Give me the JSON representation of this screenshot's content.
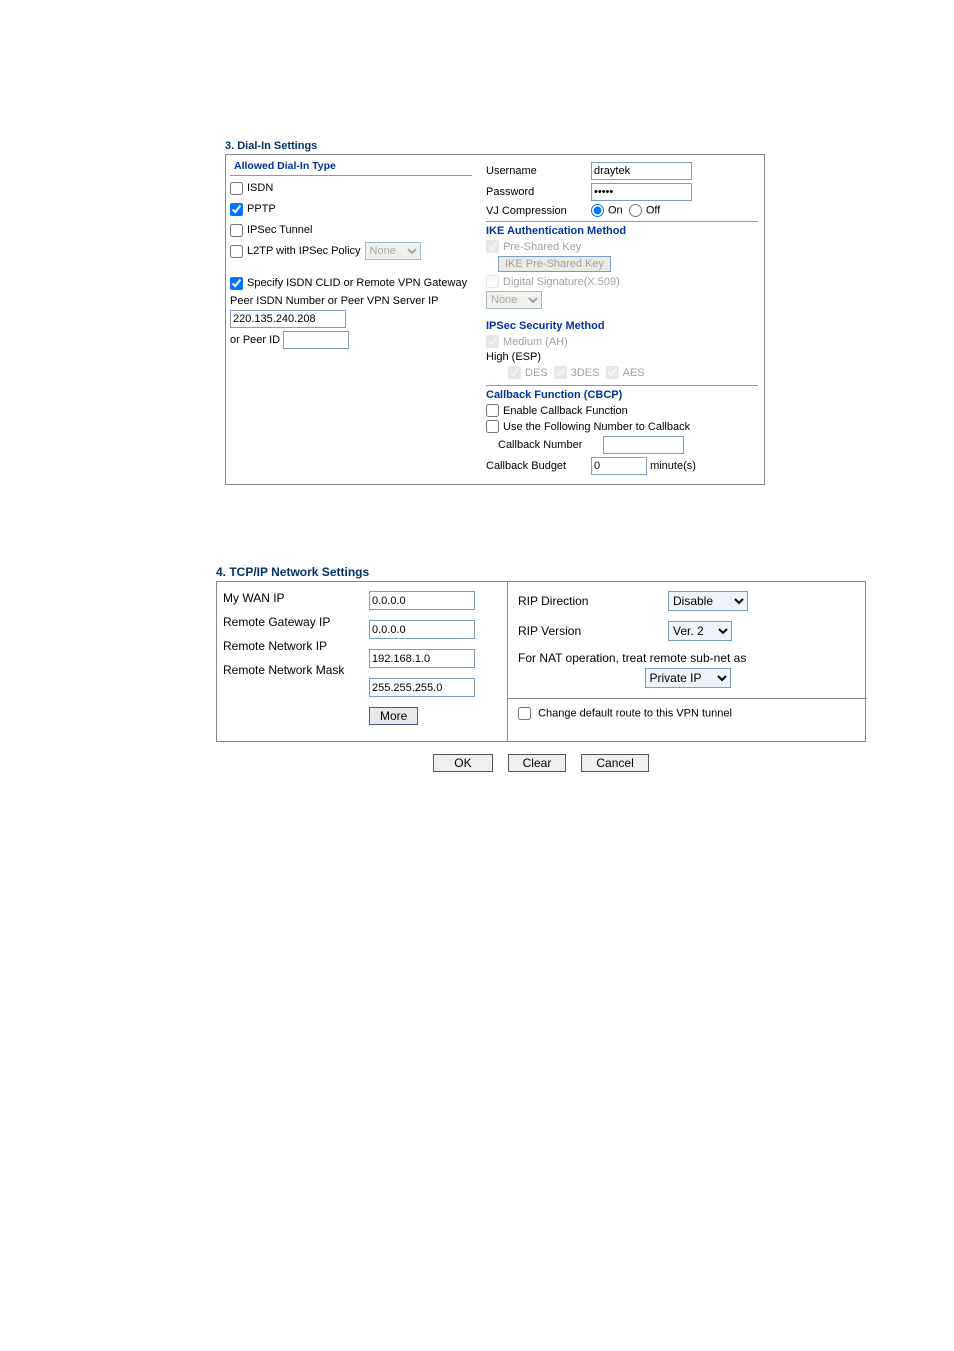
{
  "section3": {
    "title": "3. Dial-In Settings",
    "allowed_title": "Allowed Dial-In Type",
    "types": {
      "isdn": {
        "label": "ISDN",
        "checked": false
      },
      "pptp": {
        "label": "PPTP",
        "checked": true
      },
      "ipsec": {
        "label": "IPSec Tunnel",
        "checked": false
      },
      "l2tp": {
        "label": "L2TP with IPSec Policy",
        "checked": false,
        "policy": "None"
      }
    },
    "specify": {
      "label": "Specify ISDN CLID or Remote VPN Gateway",
      "checked": true
    },
    "peer_label": "Peer ISDN Number or Peer VPN Server IP",
    "peer_value": "220.135.240.208",
    "or_peer_label": "or Peer ID",
    "or_peer_value": "",
    "right": {
      "username_label": "Username",
      "username_value": "draytek",
      "password_label": "Password",
      "password_value": "•••••",
      "vj_label": "VJ Compression",
      "vj_on": "On",
      "vj_off": "Off",
      "ike_title": "IKE Authentication Method",
      "psk_label": "Pre-Shared Key",
      "psk_btn": "IKE Pre-Shared Key",
      "dsig_label": "Digital Signature(X.509)",
      "dsig_sel": "None",
      "ipsec_title": "IPSec Security Method",
      "medium": "Medium (AH)",
      "high": "High (ESP)",
      "des": "DES",
      "des3": "3DES",
      "aes": "AES",
      "cbcp_title": "Callback Function (CBCP)",
      "cb_enable": "Enable Callback Function",
      "cb_usenum": "Use the Following Number to Callback",
      "cb_number_label": "Callback Number",
      "cb_number_value": "",
      "cb_budget_label": "Callback Budget",
      "cb_budget_value": "0",
      "cb_budget_unit": "minute(s)"
    }
  },
  "section4": {
    "title": "4. TCP/IP Network Settings",
    "my_wan_label": "My WAN IP",
    "my_wan": "0.0.0.0",
    "rgw_label": "Remote Gateway IP",
    "rgw": "0.0.0.0",
    "rnet_label": "Remote Network IP",
    "rnet": "192.168.1.0",
    "rmask_label": "Remote Network Mask",
    "rmask": "255.255.255.0",
    "more": "More",
    "rip_dir_label": "RIP Direction",
    "rip_dir": "Disable",
    "rip_ver_label": "RIP Version",
    "rip_ver": "Ver. 2",
    "nat_text": "For NAT operation, treat remote sub-net as",
    "nat_sel": "Private IP",
    "change_route": "Change default route to this VPN tunnel"
  },
  "buttons": {
    "ok": "OK",
    "clear": "Clear",
    "cancel": "Cancel"
  }
}
